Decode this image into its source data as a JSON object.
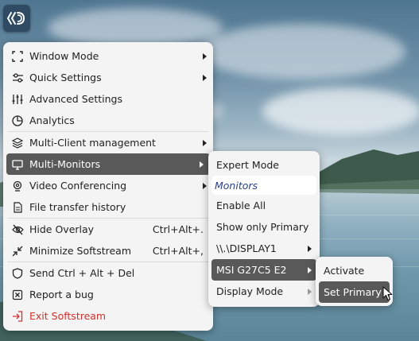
{
  "colors": {
    "menu_bg": "#f4f4f4",
    "active_bg": "#595959",
    "exit_red": "#d0312d",
    "app_btn": "#2f4a63"
  },
  "app_button": {
    "icon": "softstream-logo-icon"
  },
  "main_menu": {
    "items": [
      {
        "label": "Window Mode",
        "icon": "window-mode-icon",
        "submenu": true
      },
      {
        "label": "Quick Settings",
        "icon": "sliders-icon",
        "submenu": true
      },
      {
        "label": "Advanced Settings",
        "icon": "equalizer-icon",
        "submenu": false
      },
      {
        "label": "Analytics",
        "icon": "pie-chart-icon",
        "submenu": false
      },
      {
        "label": "Multi-Client management",
        "icon": "layers-icon",
        "submenu": true
      },
      {
        "label": "Multi-Monitors",
        "icon": "monitor-icon",
        "submenu": true,
        "active": true
      },
      {
        "label": "Video Conferencing",
        "icon": "webcam-icon",
        "submenu": true
      },
      {
        "label": "File transfer history",
        "icon": "document-icon",
        "submenu": false
      },
      {
        "label": "Hide Overlay",
        "icon": "eye-off-icon",
        "shortcut": "Ctrl+Alt+."
      },
      {
        "label": "Minimize Softstream",
        "icon": "minimize-icon",
        "shortcut": "Ctrl+Alt+,"
      },
      {
        "label": "Send Ctrl + Alt + Del",
        "icon": "shield-icon",
        "submenu": false
      },
      {
        "label": "Report a bug",
        "icon": "bug-report-icon",
        "submenu": false
      },
      {
        "label": "Exit Softstream",
        "icon": "exit-icon",
        "submenu": false
      }
    ]
  },
  "multi_monitors_menu": {
    "items": [
      {
        "label": "Expert Mode"
      },
      {
        "label": "Monitors",
        "type": "header"
      },
      {
        "label": "Enable All"
      },
      {
        "label": "Show only Primary"
      },
      {
        "label": "\\\\.\\DISPLAY1",
        "submenu": true
      },
      {
        "label": "MSI G27C5 E2",
        "submenu": true,
        "active": true
      },
      {
        "label": "Display Mode",
        "submenu": true,
        "disabled_arrow": true
      }
    ]
  },
  "monitor_menu": {
    "items": [
      {
        "label": "Activate"
      },
      {
        "label": "Set Primary",
        "active": true
      }
    ]
  }
}
